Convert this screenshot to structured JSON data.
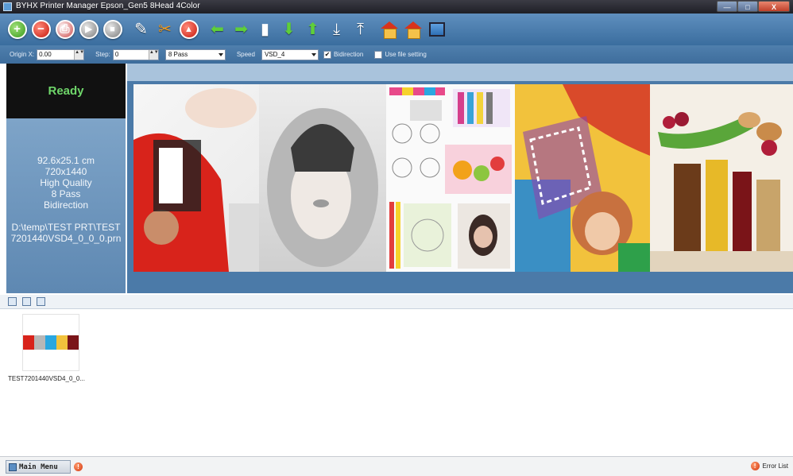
{
  "window": {
    "title": "BYHX  Printer Manager Epson_Gen5 8Head 4Color",
    "min_glyph": "—",
    "max_glyph": "□",
    "close_glyph": "X"
  },
  "toolbar": {
    "buttons": [
      {
        "name": "add",
        "icon": "plus-circle-icon",
        "glyph": "+"
      },
      {
        "name": "remove",
        "icon": "minus-circle-icon",
        "glyph": "−"
      },
      {
        "name": "print",
        "icon": "printer-icon",
        "glyph": "⎙"
      },
      {
        "name": "play",
        "icon": "play-circle-icon",
        "glyph": "▶"
      },
      {
        "name": "stop",
        "icon": "stop-circle-icon",
        "glyph": "■"
      },
      {
        "name": "clean",
        "icon": "clean-icon",
        "glyph": "✎"
      },
      {
        "name": "tools",
        "icon": "wrench-icon",
        "glyph": "✂"
      },
      {
        "name": "abort",
        "icon": "abort-icon",
        "glyph": "▲"
      },
      {
        "name": "move-left",
        "icon": "arrow-left-icon",
        "glyph": "⬅"
      },
      {
        "name": "move-right",
        "icon": "arrow-right-icon",
        "glyph": "➡"
      },
      {
        "name": "media",
        "icon": "media-icon",
        "glyph": "▮"
      },
      {
        "name": "move-down",
        "icon": "arrow-down-icon",
        "glyph": "⬇"
      },
      {
        "name": "move-up",
        "icon": "arrow-up-icon",
        "glyph": "⬆"
      },
      {
        "name": "feed-down",
        "icon": "feed-down-icon",
        "glyph": "⤓"
      },
      {
        "name": "feed-up",
        "icon": "feed-up-icon",
        "glyph": "⤒"
      },
      {
        "name": "home-x",
        "icon": "home-icon",
        "glyph": ""
      },
      {
        "name": "home-y",
        "icon": "home-icon",
        "glyph": ""
      },
      {
        "name": "monitor",
        "icon": "monitor-icon",
        "glyph": ""
      }
    ]
  },
  "options": {
    "origin_label": "Origin X:",
    "origin_value": "0.00",
    "step_label": "Step:",
    "step_value": "0",
    "pass_value": "8 Pass",
    "speed_label": "Speed",
    "speed_value": "VSD_4",
    "bidirection_label": "Bidirection",
    "bidirection_checked": "✔",
    "use_file_label": "Use file setting",
    "spin_arrows": "▲▼"
  },
  "status": {
    "state": "Ready",
    "size": "92.6x25.1 cm",
    "resolution": "720x1440",
    "quality": "High Quality",
    "pass": "8 Pass",
    "direction": "Bidirection",
    "path": "D:\\temp\\TEST PRT\\TEST7201440VSD4_0_0_0.prn"
  },
  "files": {
    "thumb_label": "TEST7201440VSD4_0_0..."
  },
  "statusbar": {
    "main_menu": "Main Menu",
    "error_list": "Error List",
    "error_glyph": "!"
  }
}
